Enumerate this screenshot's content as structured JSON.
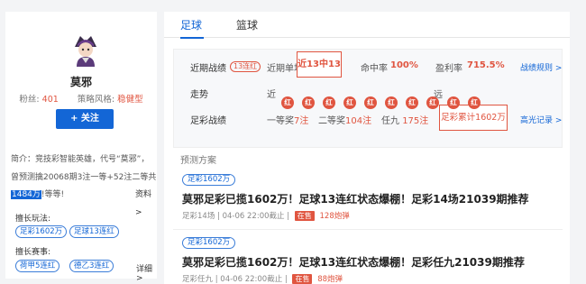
{
  "profile": {
    "name": "莫邪",
    "fans_label": "粉丝:",
    "fans_value": "401",
    "style_label": "策略风格:",
    "style_value": "稳健型",
    "follow_label": "+ 关注",
    "bio_pre": "简介：竞技彩智能英雄，代号“莫邪”，曾预测擒20068期3注一等+52注二等共",
    "bio_highlight": "1484万",
    "bio_post": "!等等!",
    "bio_more": "资料>",
    "good_play_label": "擅长玩法:",
    "good_play_tags": [
      "足彩1602万",
      "足球13连红"
    ],
    "good_league_label": "擅长赛事:",
    "good_league_tags": [
      "荷甲5连红",
      "德乙3连红"
    ],
    "detail_link": "详细>"
  },
  "tabs": [
    {
      "label": "足球",
      "active": true
    },
    {
      "label": "篮球",
      "active": false
    }
  ],
  "summary": {
    "recent_label": "近期战绩",
    "streak_tag": "13连红",
    "recent_single_label": "近期单场",
    "recent_single_value": "近13中13",
    "hit_rate_label": "命中率",
    "hit_rate_value": "100%",
    "profit_label": "盈利率",
    "profit_value": "715.5%",
    "rules_link": "战绩规则 >",
    "trend_label": "走势",
    "trend_near": "近",
    "trend_far": "远",
    "trend_balls": [
      "红",
      "红",
      "红",
      "红",
      "红",
      "红",
      "红",
      "红",
      "红",
      "红"
    ],
    "lottery_label": "足彩战绩",
    "first_prize_label": "一等奖",
    "first_prize_value": "7注",
    "second_prize_label": "二等奖",
    "second_prize_value": "104注",
    "ren9_label": "任九",
    "ren9_value": "175注",
    "cumulative": "足彩累计1602万",
    "highlight_link": "高光记录 >"
  },
  "plans_title": "预测方案",
  "plans": [
    {
      "tag": "足彩1602万",
      "title": "莫邪足彩已揽1602万！足球13连红状态爆棚！足彩14场21039期推荐",
      "game": "足彩14场",
      "deadline": "04-06 22:00截止",
      "status": "在售",
      "price": "128炮弹"
    },
    {
      "tag": "足彩1602万",
      "title": "莫邪足彩已揽1602万！足球13连红状态爆棚！足彩任九21039期推荐",
      "game": "足彩任九",
      "deadline": "04-06 22:00截止",
      "status": "在售",
      "price": "88炮弹"
    }
  ],
  "colors": {
    "accent": "#1366d6",
    "red": "#e05540"
  }
}
